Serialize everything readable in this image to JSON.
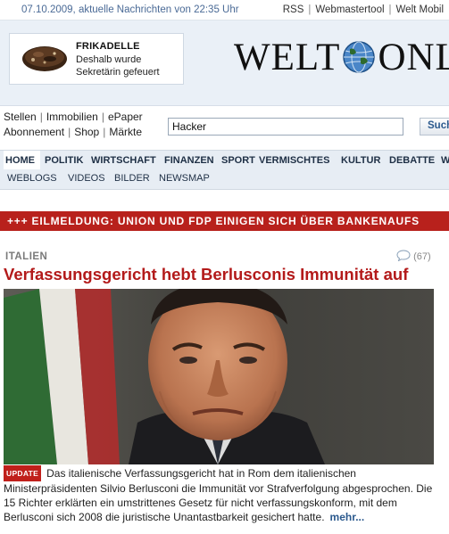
{
  "topbar": {
    "date_line": "07.10.2009, aktuelle Nachrichten von 22:35 Uhr",
    "links": [
      "RSS",
      "Webmastertool",
      "Welt Mobil"
    ]
  },
  "teaser": {
    "title": "FRIKADELLE",
    "text": "Deshalb wurde Sekretärin gefeuert"
  },
  "logo": {
    "part1": "WELT",
    "part2": "ONL"
  },
  "quicklinks": {
    "row1": [
      "Stellen",
      "Immobilien",
      "ePaper"
    ],
    "row2": [
      "Abonnement",
      "Shop",
      "Märkte"
    ]
  },
  "search": {
    "value": "Hacker",
    "button": "Such"
  },
  "mainnav": [
    "HOME",
    "POLITIK",
    "WIRTSCHAFT",
    "FINANZEN",
    "SPORT",
    "VERMISCHTES",
    "KULTUR",
    "DEBATTE",
    "W"
  ],
  "subnav": [
    "WEBLOGS",
    "VIDEOS",
    "BILDER",
    "NEWSMAP"
  ],
  "breaking": "+++ EILMELDUNG: UNION UND FDP EINIGEN SICH ÜBER BANKENAUFS",
  "article": {
    "kicker": "ITALIEN",
    "comments": "(67)",
    "headline": "Verfassungsgericht hebt Berlusconis Immunität auf",
    "badge": "UPDATE",
    "lead": "Das italienische Verfassungsgericht hat in Rom dem italienischen Ministerpräsidenten Silvio Berlusconi die Immunität vor Strafverfolgung abgesprochen. Die 15 Richter erklärten ein umstrittenes Gesetz für nicht verfassungskonform, mit dem Berlusconi sich 2008 die juristische Unantastbarkeit gesichert hatte.",
    "more": "mehr..."
  },
  "colors": {
    "accent_red": "#b31a1a",
    "breaking_bg": "#b8211c",
    "nav_bg": "#e7edf4",
    "link_blue": "#2c5a8e"
  },
  "icons": {
    "comments": "speech-bubble-icon",
    "logo_globe": "globe-icon"
  }
}
